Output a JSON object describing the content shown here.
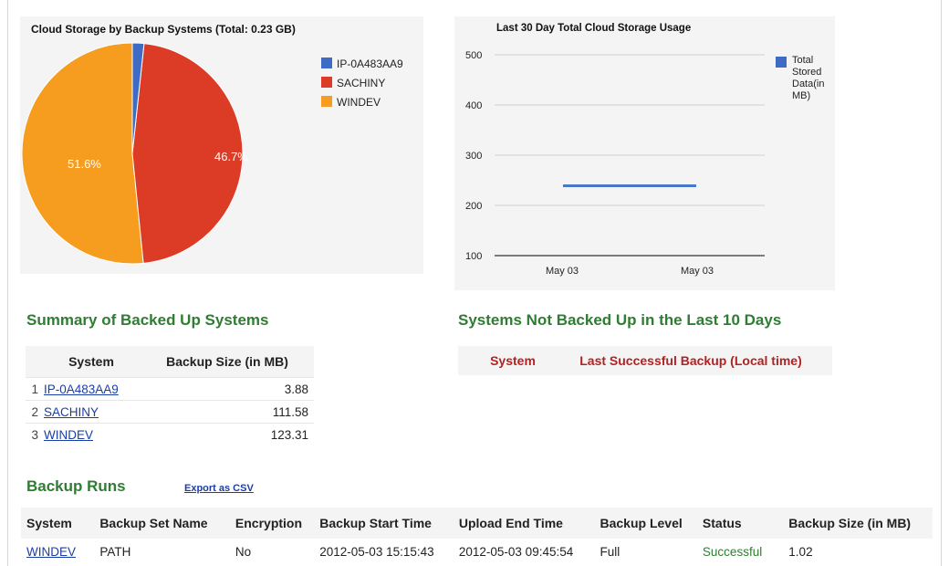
{
  "pie_chart": {
    "title": "Cloud Storage by Backup Systems (Total: 0.23 GB)",
    "legend": [
      {
        "label": "IP-0A483AA9",
        "color": "#3e6cc4"
      },
      {
        "label": "SACHINY",
        "color": "#dc3b26"
      },
      {
        "label": "WINDEV",
        "color": "#f69c1e"
      }
    ],
    "slice_labels": {
      "windev": "51.6%",
      "sachiny": "46.7%"
    }
  },
  "line_chart": {
    "title": "Last 30 Day Total Cloud Storage Usage",
    "legend_label": "Total Stored Data(in MB)",
    "y_ticks": [
      "500",
      "400",
      "300",
      "200",
      "100"
    ],
    "x_ticks": [
      "May 03",
      "May 03"
    ]
  },
  "chart_data": [
    {
      "type": "pie",
      "title": "Cloud Storage by Backup Systems (Total: 0.23 GB)",
      "categories": [
        "IP-0A483AA9",
        "SACHINY",
        "WINDEV"
      ],
      "values": [
        1.7,
        46.7,
        51.6
      ],
      "colors": [
        "#3e6cc4",
        "#dc3b26",
        "#f69c1e"
      ],
      "legend": "top-right"
    },
    {
      "type": "line",
      "title": "Last 30 Day Total Cloud Storage Usage",
      "x": [
        "May 03",
        "May 03"
      ],
      "series": [
        {
          "name": "Total Stored Data(in MB)",
          "values": [
            239,
            239
          ],
          "color": "#4a78c8"
        }
      ],
      "ylim": [
        100,
        500
      ],
      "grid": true,
      "legend": "right"
    }
  ],
  "summary": {
    "title": "Summary of Backed Up Systems",
    "headers": [
      "System",
      "Backup Size (in MB)"
    ],
    "rows": [
      {
        "num": "1",
        "system": "IP-0A483AA9",
        "size": "3.88"
      },
      {
        "num": "2",
        "system": "SACHINY",
        "size": "111.58"
      },
      {
        "num": "3",
        "system": "WINDEV",
        "size": "123.31"
      }
    ]
  },
  "not_backed_up": {
    "title": "Systems Not Backed Up in the Last 10 Days",
    "headers": [
      "System",
      "Last Successful Backup (Local time)"
    ]
  },
  "runs": {
    "title": "Backup Runs",
    "export_label": "Export as CSV",
    "headers": [
      "System",
      "Backup Set Name",
      "Encryption",
      "Backup Start Time",
      "Upload End Time",
      "Backup Level",
      "Status",
      "Backup Size (in MB)"
    ],
    "rows": [
      {
        "system": "WINDEV",
        "set": "PATH",
        "encryption": "No",
        "start": "2012-05-03 15:15:43",
        "end": "2012-05-03 09:45:54",
        "level": "Full",
        "status": "Successful",
        "size": "1.02"
      }
    ],
    "status_color": "#2e7d32"
  }
}
